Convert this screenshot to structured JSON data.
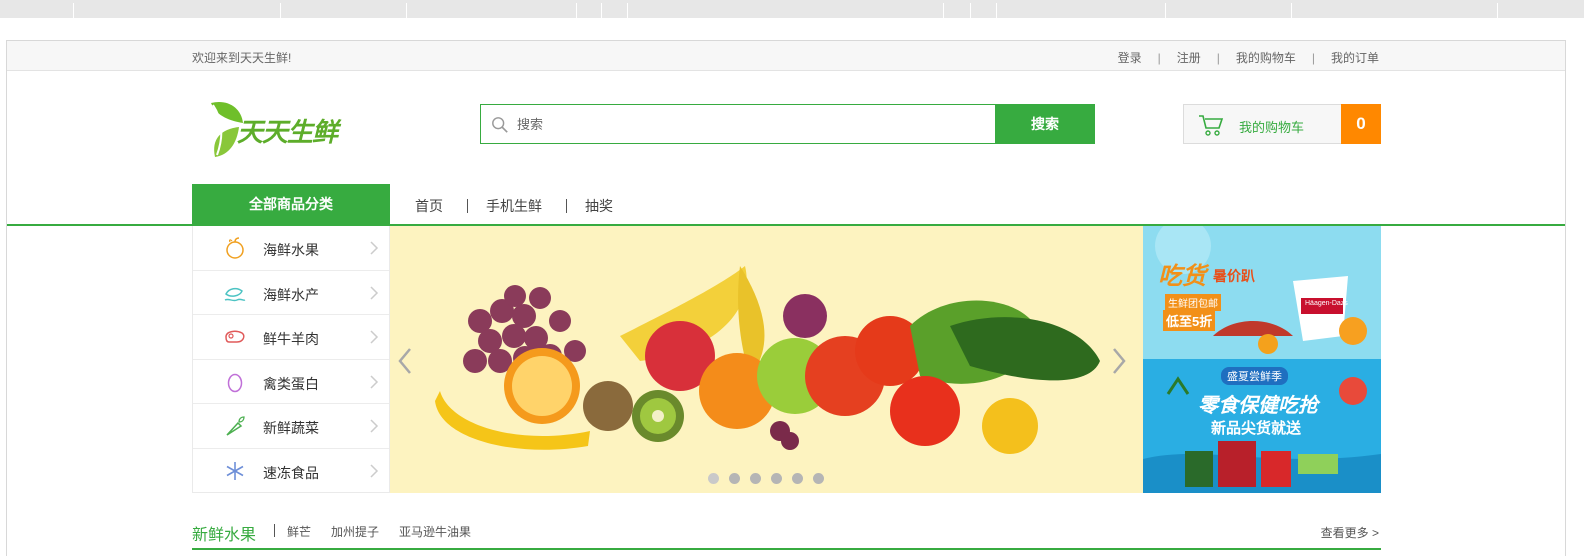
{
  "header": {
    "welcome": "欢迎来到天天生鲜!",
    "links": [
      "登录",
      "注册",
      "我的购物车",
      "我的订单"
    ],
    "separator": "|"
  },
  "logo": {
    "text": "天天生鲜"
  },
  "search": {
    "placeholder": "搜索",
    "button_label": "搜索"
  },
  "cart": {
    "label": "我的购物车",
    "count": "0"
  },
  "nav": {
    "all_categories": "全部商品分类",
    "links": [
      "首页",
      "手机生鲜",
      "抽奖"
    ]
  },
  "categories": [
    {
      "label": "海鲜水果",
      "icon": "fruit-icon"
    },
    {
      "label": "海鲜水产",
      "icon": "seafood-icon"
    },
    {
      "label": "鲜牛羊肉",
      "icon": "meat-icon"
    },
    {
      "label": "禽类蛋白",
      "icon": "egg-icon"
    },
    {
      "label": "新鲜蔬菜",
      "icon": "vegetable-icon"
    },
    {
      "label": "速冻食品",
      "icon": "frozen-icon"
    }
  ],
  "banner": {
    "slide_count": 6,
    "active_slide": 1
  },
  "ads": {
    "ad1": {
      "line1": "吃货",
      "line2": "暑价趴",
      "line3": "生鲜团包邮",
      "line4": "低至5折",
      "brand": "Häagen-Dazs"
    },
    "ad2": {
      "line1": "盛夏尝鲜季",
      "line2": "零食保健吃抢",
      "line3": "新品尖货就送"
    }
  },
  "section": {
    "title": "新鲜水果",
    "tags": [
      "鲜芒",
      "加州提子",
      "亚马逊牛油果"
    ],
    "more": "查看更多 >"
  },
  "colors": {
    "brand_green": "#37ab40",
    "cart_orange": "#ff8800",
    "banner_bg": "#fdf3c0"
  }
}
